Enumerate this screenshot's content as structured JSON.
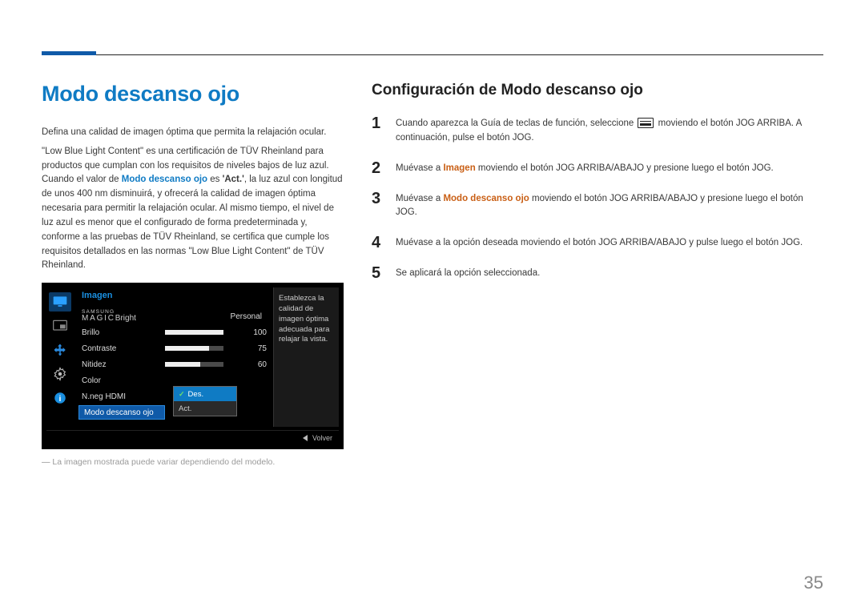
{
  "page_number": "35",
  "left": {
    "heading": "Modo descanso ojo",
    "p1": "Defina una calidad de imagen óptima que permita la relajación ocular.",
    "p2_a": "\"Low Blue Light Content\" es una certificación de TÜV Rheinland para productos que cumplan con los requisitos de niveles bajos de luz azul. Cuando el valor de ",
    "p2_feature": "Modo descanso ojo",
    "p2_b": " es ",
    "p2_value": "'Act.'",
    "p2_c": ", la luz azul con longitud de unos 400 nm disminuirá, y ofrecerá la calidad de imagen óptima necesaria para permitir la relajación ocular. Al mismo tiempo, el nivel de luz azul es menor que el configurado de forma predeterminada y, conforme a las pruebas de TÜV Rheinland, se certifica que cumple los requisitos detallados en las normas \"Low Blue Light Content\" de TÜV Rheinland.",
    "caption": "La imagen mostrada puede variar dependiendo del modelo."
  },
  "right": {
    "heading": "Configuración de Modo descanso ojo",
    "steps": [
      {
        "pre": "Cuando aparezca la Guía de teclas de función, seleccione ",
        "has_icon": true,
        "post": " moviendo el botón JOG ARRIBA. A continuación, pulse el botón JOG."
      },
      {
        "pre": "Muévase a ",
        "hl": "Imagen",
        "hl_class": "bold-orange",
        "post": " moviendo el botón JOG ARRIBA/ABAJO y presione luego el botón JOG."
      },
      {
        "pre": "Muévase a ",
        "hl": "Modo descanso ojo",
        "hl_class": "bold-orange",
        "post": " moviendo el botón JOG ARRIBA/ABAJO y presione luego el botón JOG."
      },
      {
        "pre": "Muévase a la opción deseada moviendo el botón JOG ARRIBA/ABAJO y pulse luego el botón JOG."
      },
      {
        "pre": "Se aplicará la opción seleccionada."
      }
    ]
  },
  "osd": {
    "title": "Imagen",
    "help": "Establezca la calidad de imagen óptima adecuada para relajar la vista.",
    "back": "Volver",
    "magic_value": "Personal",
    "rows": [
      {
        "label": "Brillo",
        "value": 100,
        "pct": 100
      },
      {
        "label": "Contraste",
        "value": 75,
        "pct": 75
      },
      {
        "label": "Nitidez",
        "value": 60,
        "pct": 60
      }
    ],
    "plain_rows": [
      {
        "label": "Color"
      },
      {
        "label": "N.neg HDMI"
      }
    ],
    "selected_row": "Modo descanso ojo",
    "popup": [
      {
        "label": "Des.",
        "selected": true
      },
      {
        "label": "Act.",
        "selected": false
      }
    ]
  }
}
